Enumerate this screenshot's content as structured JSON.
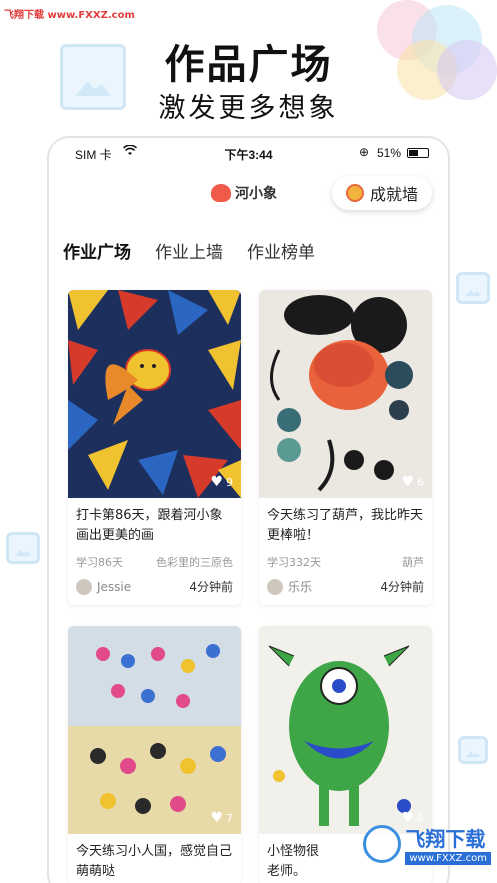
{
  "watermark": {
    "top_left": "飞翔下载 www.FXXZ.com",
    "brand": "飞翔下载",
    "url": "www.FXXZ.com"
  },
  "hero": {
    "title": "作品广场",
    "subtitle": "激发更多想象"
  },
  "status_bar": {
    "carrier": "SIM 卡",
    "time": "下午3:44",
    "battery": "51%",
    "battery_level": 0.51
  },
  "app": {
    "logo_text": "河小象",
    "achievement_button": "成就墙"
  },
  "tabs": [
    {
      "label": "作业广场",
      "active": true
    },
    {
      "label": "作业上墙",
      "active": false
    },
    {
      "label": "作业榜单",
      "active": false
    }
  ],
  "cards": [
    {
      "title": "打卡第86天，跟着河小象画出更美的画",
      "days": "学习86天",
      "course": "色彩里的三原色",
      "user": "Jessie",
      "time": "4分钟前",
      "likes": "9"
    },
    {
      "title": "今天练习了葫芦，我比昨天更棒啦！",
      "days": "学习332天",
      "course": "葫芦",
      "user": "乐乐",
      "time": "4分钟前",
      "likes": "6"
    },
    {
      "title": "今天练习小人国，感觉自己萌萌哒",
      "days": "",
      "course": "",
      "user": "",
      "time": "",
      "likes": "7"
    },
    {
      "title": "小怪物很",
      "days": "",
      "course": "",
      "user": "",
      "time": "",
      "likes": "6",
      "title_line2": "老师。"
    }
  ],
  "colors": {
    "accent": "#ef5a4a",
    "tab_underline": "#f8c6c1",
    "watermark_blue": "#2a6fd6"
  }
}
